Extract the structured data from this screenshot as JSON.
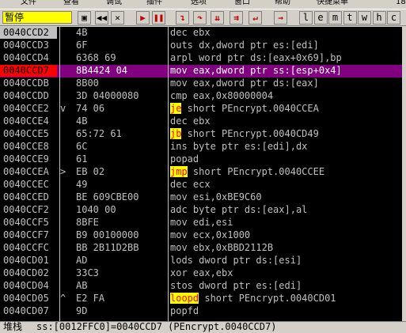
{
  "menu": {
    "items": [
      "文件",
      "查看",
      "调试",
      "插件",
      "选项",
      "窗口",
      "帮助",
      "快捷菜单"
    ],
    "suffix": "18"
  },
  "toolbar": {
    "state": "暂停",
    "buttons": [
      {
        "name": "open-icon",
        "glyph": "▣"
      },
      {
        "name": "rewind-icon",
        "glyph": "◀◀"
      },
      {
        "name": "close-icon",
        "glyph": "✕"
      },
      {
        "name": "run-icon",
        "glyph": "▶"
      },
      {
        "name": "pause-icon",
        "glyph": "❚❚"
      },
      {
        "name": "step-into-icon",
        "glyph": "↴"
      },
      {
        "name": "step-over-icon",
        "glyph": "↷"
      },
      {
        "name": "trace-into-icon",
        "glyph": "⇊"
      },
      {
        "name": "trace-over-icon",
        "glyph": "⇉"
      },
      {
        "name": "execute-till-return-icon",
        "glyph": "↵"
      },
      {
        "name": "goto-icon",
        "glyph": "→"
      }
    ],
    "letters": [
      "l",
      "e",
      "m",
      "t",
      "w",
      "h",
      "c"
    ]
  },
  "rows": [
    {
      "addr": "0040CCD2",
      "mark": "",
      "hex": "4B",
      "asm": [
        {
          "t": "dec ebx"
        }
      ],
      "style": "first"
    },
    {
      "addr": "0040CCD3",
      "mark": "",
      "hex": "6F",
      "asm": [
        {
          "t": "outs dx,dword ptr es:[edi]"
        }
      ]
    },
    {
      "addr": "0040CCD4",
      "mark": "",
      "hex": "6368 69",
      "asm": [
        {
          "t": "arpl word ptr ds:[eax+0x69],bp"
        }
      ]
    },
    {
      "addr": "0040CCD7",
      "mark": "",
      "hex": "8B4424 04",
      "asm": [
        {
          "t": "mov eax,dword ptr ss:[esp+0x4]"
        }
      ],
      "style": "eip"
    },
    {
      "addr": "0040CCDB",
      "mark": "",
      "hex": "8B00",
      "asm": [
        {
          "t": "mov eax,dword ptr ds:[eax]"
        }
      ]
    },
    {
      "addr": "0040CCDD",
      "mark": "",
      "hex": "3D 04000080",
      "asm": [
        {
          "t": "cmp eax,0x80000004"
        }
      ]
    },
    {
      "addr": "0040CCE2",
      "mark": "v",
      "hex": "74 06",
      "asm": [
        {
          "t": "je",
          "hl": true
        },
        {
          "t": " short PEncrypt.0040CCEA"
        }
      ]
    },
    {
      "addr": "0040CCE4",
      "mark": "",
      "hex": "4B",
      "asm": [
        {
          "t": "dec ebx"
        }
      ]
    },
    {
      "addr": "0040CCE5",
      "mark": "",
      "hex": "65:72 61",
      "asm": [
        {
          "t": "jb",
          "hl": true
        },
        {
          "t": " short PEncrypt.0040CD49"
        }
      ]
    },
    {
      "addr": "0040CCE8",
      "mark": "",
      "hex": "6C",
      "asm": [
        {
          "t": "ins byte ptr es:[edi],dx"
        }
      ]
    },
    {
      "addr": "0040CCE9",
      "mark": "",
      "hex": "61",
      "asm": [
        {
          "t": "popad"
        }
      ]
    },
    {
      "addr": "0040CCEA",
      "mark": ">",
      "hex": "EB 02",
      "asm": [
        {
          "t": "jmp",
          "hl": true
        },
        {
          "t": " short PEncrypt.0040CCEE"
        }
      ]
    },
    {
      "addr": "0040CCEC",
      "mark": "",
      "hex": "49",
      "asm": [
        {
          "t": "dec ecx"
        }
      ]
    },
    {
      "addr": "0040CCED",
      "mark": "",
      "hex": "BE 609CBE00",
      "asm": [
        {
          "t": "mov esi,0xBE9C60"
        }
      ]
    },
    {
      "addr": "0040CCF2",
      "mark": "",
      "hex": "1040 00",
      "asm": [
        {
          "t": "adc byte ptr ds:[eax],al"
        }
      ]
    },
    {
      "addr": "0040CCF5",
      "mark": "",
      "hex": "8BFE",
      "asm": [
        {
          "t": "mov edi,esi"
        }
      ]
    },
    {
      "addr": "0040CCF7",
      "mark": "",
      "hex": "B9 00100000",
      "asm": [
        {
          "t": "mov ecx,0x1000"
        }
      ]
    },
    {
      "addr": "0040CCFC",
      "mark": "",
      "hex": "BB 2B11D2BB",
      "asm": [
        {
          "t": "mov ebx,0xBBD2112B"
        }
      ]
    },
    {
      "addr": "0040CD01",
      "mark": "",
      "hex": "AD",
      "asm": [
        {
          "t": "lods dword ptr ds:[esi]"
        }
      ]
    },
    {
      "addr": "0040CD02",
      "mark": "",
      "hex": "33C3",
      "asm": [
        {
          "t": "xor eax,ebx"
        }
      ]
    },
    {
      "addr": "0040CD04",
      "mark": "",
      "hex": "AB",
      "asm": [
        {
          "t": "stos dword ptr es:[edi]"
        }
      ]
    },
    {
      "addr": "0040CD05",
      "mark": "^",
      "hex": "E2 FA",
      "asm": [
        {
          "t": "loopd",
          "hl": true
        },
        {
          "t": " short PEncrypt.0040CD01"
        }
      ]
    },
    {
      "addr": "0040CD07",
      "mark": "",
      "hex": "9D",
      "asm": [
        {
          "t": "popfd"
        }
      ]
    }
  ],
  "selected_row_index": 3,
  "status": {
    "label": "堆栈",
    "text": "ss:[0012FFC0]=0040CCD7 (PEncrypt.0040CCD7)"
  },
  "colors": {
    "background": "#000000",
    "selected_row": "#800080",
    "eip_address": "#ff0000",
    "jump_highlight": "#ffff00",
    "jump_text": "#ff0000",
    "state_badge": "#ffff00"
  }
}
